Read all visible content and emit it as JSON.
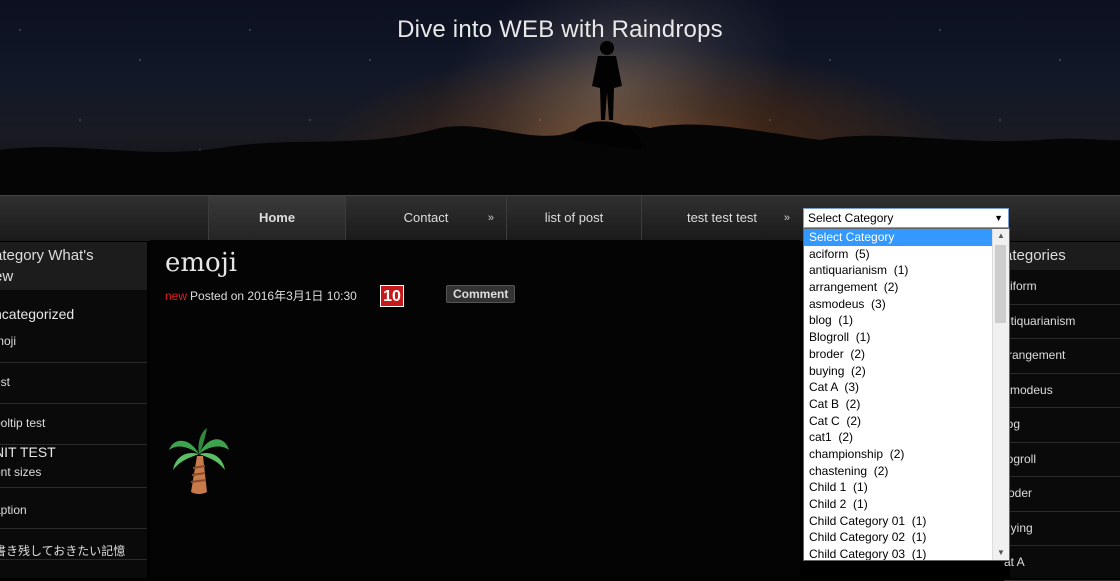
{
  "site": {
    "title": "Dive into WEB with Raindrops"
  },
  "nav": {
    "items": [
      {
        "label": "Home"
      },
      {
        "label": "Contact"
      },
      {
        "label": "list of post"
      },
      {
        "label": "test test test"
      }
    ]
  },
  "category_select": {
    "value": "Select Category",
    "options": [
      "Select Category",
      "aciform  (5)",
      "antiquarianism  (1)",
      "arrangement  (2)",
      "asmodeus  (3)",
      "blog  (1)",
      "Blogroll  (1)",
      "broder  (2)",
      "buying  (2)",
      "Cat A  (3)",
      "Cat B  (2)",
      "Cat C  (2)",
      "cat1  (2)",
      "championship  (2)",
      "chastening  (2)",
      "Child 1  (1)",
      "Child 2  (1)",
      "Child Category 01  (1)",
      "Child Category 02  (1)",
      "Child Category 03  (1)"
    ]
  },
  "left_sidebar": {
    "title": "ategory What's\new",
    "groups": [
      {
        "heading": "ncategorized",
        "items": [
          "moji",
          "est",
          "ooltip test"
        ]
      },
      {
        "heading": "NIT TEST",
        "items": [
          "ont sizes",
          "aption",
          "書き残しておきたい記憶"
        ]
      }
    ]
  },
  "post": {
    "title": "emoji",
    "new_label": "new",
    "meta": "Posted on 2016年3月1日 10:30",
    "calendar_day": "10",
    "comment_label": "Comment"
  },
  "right_sidebar": {
    "title": "ategories",
    "items": [
      "ciform",
      "ntiquarianism",
      "rrangement",
      "smodeus",
      "log",
      "logroll",
      "roder",
      "uying",
      "at A"
    ]
  },
  "colors": {
    "accent_select": "#3399ff",
    "new_label": "#e02020",
    "calendar": "#c51a1a"
  }
}
